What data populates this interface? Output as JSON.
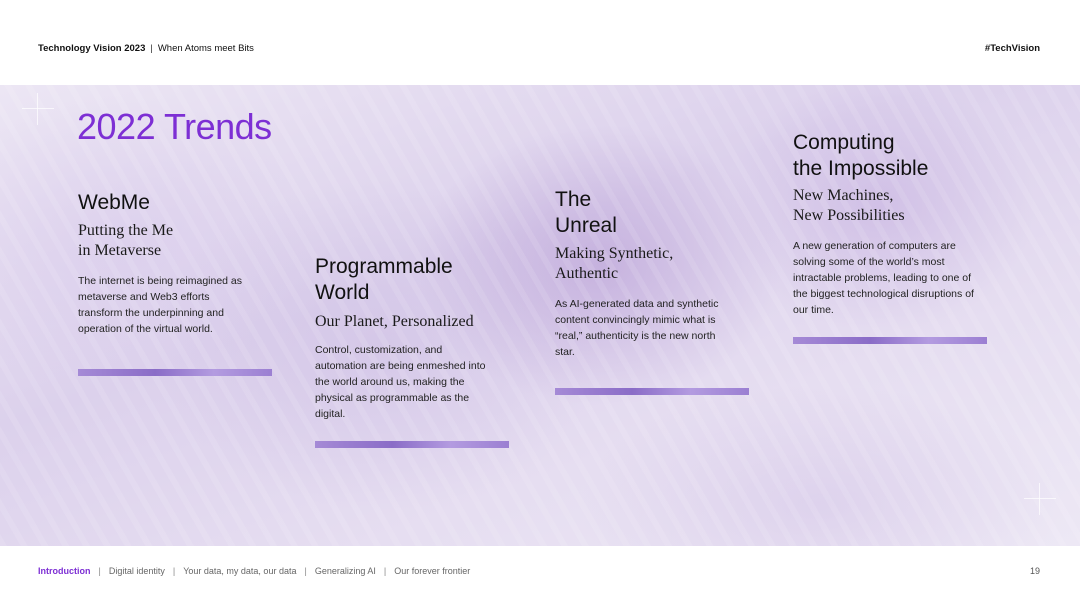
{
  "header": {
    "title": "Technology Vision 2023",
    "separator": "|",
    "subtitle": "When Atoms meet Bits",
    "hashtag": "#TechVision"
  },
  "main": {
    "title": "2022 Trends",
    "trends": [
      {
        "title_line1": "WebMe",
        "title_line2": "",
        "subtitle_line1": "Putting the Me",
        "subtitle_line2": "in Metaverse",
        "body": "The internet is being reimagined as metaverse and Web3 efforts transform the underpinning and operation of the virtual world."
      },
      {
        "title_line1": "Programmable",
        "title_line2": "World",
        "subtitle_line1": "Our Planet, Personalized",
        "subtitle_line2": "",
        "body": "Control, customization, and automation are being enmeshed into the world around us, making the physical as programmable as the digital."
      },
      {
        "title_line1": "The",
        "title_line2": "Unreal",
        "subtitle_line1": "Making Synthetic,",
        "subtitle_line2": "Authentic",
        "body": "As AI-generated data and synthetic content convincingly mimic what is “real,” authenticity is the new north star."
      },
      {
        "title_line1": "Computing",
        "title_line2": "the Impossible",
        "subtitle_line1": "New Machines,",
        "subtitle_line2": "New Possibilities",
        "body": "A new generation of computers are solving some of the world’s most intractable problems, leading to one of the biggest technological disruptions of our time."
      }
    ]
  },
  "footer": {
    "nav": [
      {
        "label": "Introduction",
        "active": true
      },
      {
        "label": "Digital identity",
        "active": false
      },
      {
        "label": "Your data, my data, our data",
        "active": false
      },
      {
        "label": "Generalizing AI",
        "active": false
      },
      {
        "label": "Our forever frontier",
        "active": false
      }
    ],
    "nav_separator": "|",
    "page_number": "19"
  },
  "colors": {
    "accent": "#7d2fd4",
    "bar": "#9b7fd2"
  }
}
